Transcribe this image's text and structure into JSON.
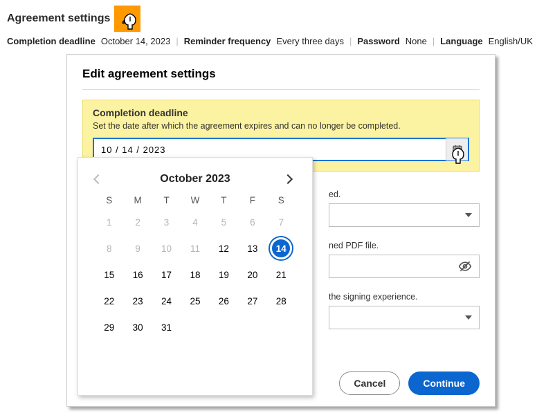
{
  "header": {
    "title": "Agreement settings"
  },
  "summary": {
    "deadline_label": "Completion deadline",
    "deadline_value": "October 14, 2023",
    "reminder_label": "Reminder frequency",
    "reminder_value": "Every three days",
    "password_label": "Password",
    "password_value": "None",
    "language_label": "Language",
    "language_value": "English/UK"
  },
  "modal": {
    "title": "Edit agreement settings",
    "deadline": {
      "label": "Completion deadline",
      "description": "Set the date after which the agreement expires and can no longer be completed.",
      "value": "10 / 14 / 2023"
    },
    "reminder_desc_fragment": "ed.",
    "password_desc_fragment": "ned PDF file.",
    "language_desc_fragment": "the signing experience.",
    "buttons": {
      "cancel": "Cancel",
      "continue": "Continue"
    }
  },
  "calendar": {
    "month_label": "October 2023",
    "dow": [
      "S",
      "M",
      "T",
      "W",
      "T",
      "F",
      "S"
    ],
    "cells": [
      {
        "n": "1",
        "dim": true
      },
      {
        "n": "2",
        "dim": true
      },
      {
        "n": "3",
        "dim": true
      },
      {
        "n": "4",
        "dim": true
      },
      {
        "n": "5",
        "dim": true
      },
      {
        "n": "6",
        "dim": true
      },
      {
        "n": "7",
        "dim": true
      },
      {
        "n": "8",
        "dim": true
      },
      {
        "n": "9",
        "dim": true
      },
      {
        "n": "10",
        "dim": true
      },
      {
        "n": "11",
        "dim": true
      },
      {
        "n": "12",
        "dim": false
      },
      {
        "n": "13",
        "dim": false
      },
      {
        "n": "14",
        "dim": false,
        "sel": true
      },
      {
        "n": "15",
        "dim": false
      },
      {
        "n": "16",
        "dim": false
      },
      {
        "n": "17",
        "dim": false
      },
      {
        "n": "18",
        "dim": false
      },
      {
        "n": "19",
        "dim": false
      },
      {
        "n": "20",
        "dim": false
      },
      {
        "n": "21",
        "dim": false
      },
      {
        "n": "22",
        "dim": false
      },
      {
        "n": "23",
        "dim": false
      },
      {
        "n": "24",
        "dim": false
      },
      {
        "n": "25",
        "dim": false
      },
      {
        "n": "26",
        "dim": false
      },
      {
        "n": "27",
        "dim": false
      },
      {
        "n": "28",
        "dim": false
      },
      {
        "n": "29",
        "dim": false
      },
      {
        "n": "30",
        "dim": false
      },
      {
        "n": "31",
        "dim": false
      }
    ]
  }
}
